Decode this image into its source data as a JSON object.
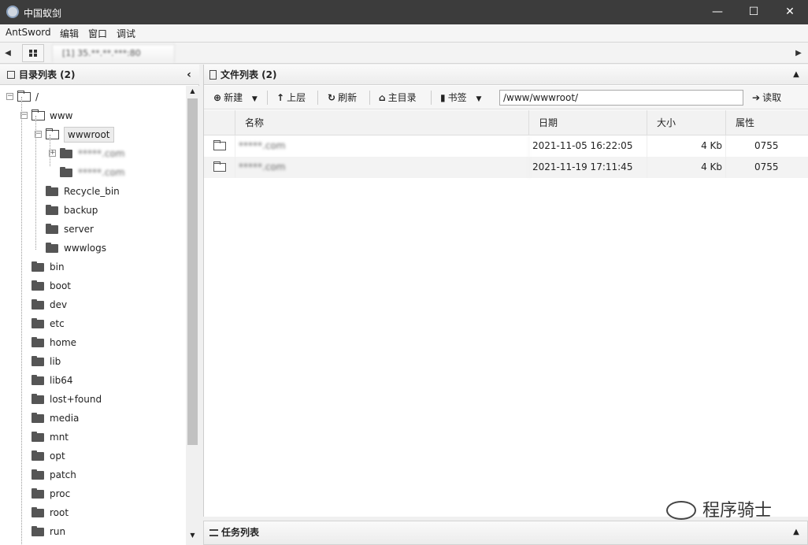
{
  "window": {
    "title": "中国蚁剑",
    "minimize": "—",
    "maximize": "☐",
    "close": "✕"
  },
  "menu": [
    "AntSword",
    "编辑",
    "窗口",
    "调试"
  ],
  "tabs": {
    "active_label": "[1] 35.**.**.***:80"
  },
  "left": {
    "title": "目录列表 (2)",
    "tree": [
      {
        "label": "/",
        "depth": 0,
        "open": true
      },
      {
        "label": "www",
        "depth": 1,
        "open": true
      },
      {
        "label": "wwwroot",
        "depth": 2,
        "open": true,
        "selected": true
      },
      {
        "label": "*****.com",
        "depth": 3,
        "blurred": true
      },
      {
        "label": "*****.com",
        "depth": 3,
        "blurred": true
      },
      {
        "label": "Recycle_bin",
        "depth": 2
      },
      {
        "label": "backup",
        "depth": 2
      },
      {
        "label": "server",
        "depth": 2
      },
      {
        "label": "wwwlogs",
        "depth": 2
      },
      {
        "label": "bin",
        "depth": 1
      },
      {
        "label": "boot",
        "depth": 1
      },
      {
        "label": "dev",
        "depth": 1
      },
      {
        "label": "etc",
        "depth": 1
      },
      {
        "label": "home",
        "depth": 1
      },
      {
        "label": "lib",
        "depth": 1
      },
      {
        "label": "lib64",
        "depth": 1
      },
      {
        "label": "lost+found",
        "depth": 1
      },
      {
        "label": "media",
        "depth": 1
      },
      {
        "label": "mnt",
        "depth": 1
      },
      {
        "label": "opt",
        "depth": 1
      },
      {
        "label": "patch",
        "depth": 1
      },
      {
        "label": "proc",
        "depth": 1
      },
      {
        "label": "root",
        "depth": 1
      },
      {
        "label": "run",
        "depth": 1
      }
    ]
  },
  "right": {
    "title": "文件列表 (2)",
    "toolbar": {
      "new": "新建",
      "up": "上层",
      "refresh": "刷新",
      "home": "主目录",
      "bookmark": "书签",
      "path": "/www/wwwroot/",
      "read": "读取"
    },
    "columns": [
      "名称",
      "日期",
      "大小",
      "属性"
    ],
    "rows": [
      {
        "name": "*****.com",
        "date": "2021-11-05 16:22:05",
        "size": "4 Kb",
        "perm": "0755"
      },
      {
        "name": "*****.com",
        "date": "2021-11-19 17:11:45",
        "size": "4 Kb",
        "perm": "0755"
      }
    ]
  },
  "tasks": {
    "title": "任务列表"
  },
  "watermark": "程序骑士"
}
